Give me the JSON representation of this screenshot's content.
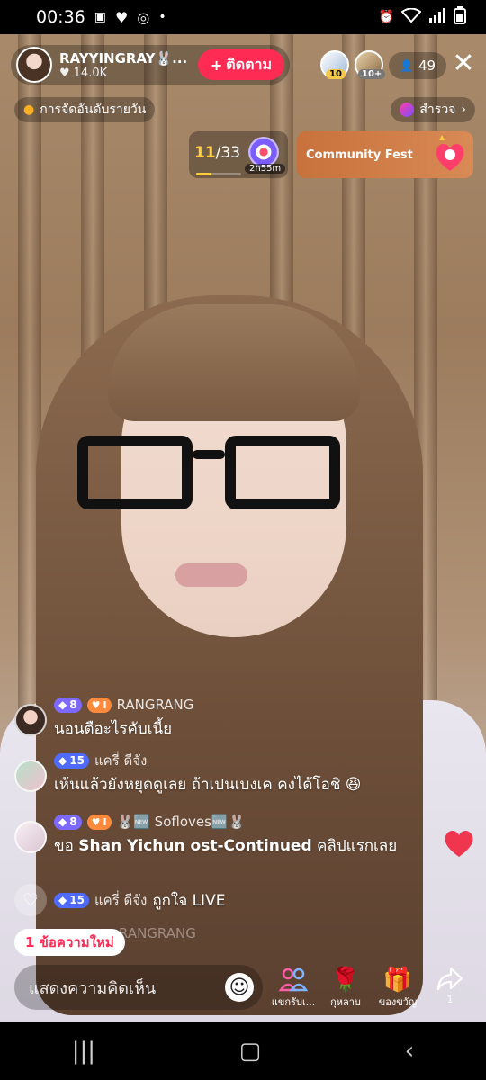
{
  "status_bar": {
    "time": "00:36",
    "dot": "•"
  },
  "host": {
    "name": "RAYYINGRAY🐰...",
    "likes": "14.0K",
    "follow_label": "ติดตาม"
  },
  "viewers": {
    "count": "49",
    "badge1": "10",
    "badge2": "10+"
  },
  "ranking": {
    "label": "การจัดอันดับรายวัน"
  },
  "explore": {
    "label": "สำรวจ"
  },
  "goal": {
    "done": "11",
    "total": "/33",
    "timer": "2h55m",
    "progress": 0.333
  },
  "fest": {
    "label": "Community Fest"
  },
  "chat": [
    {
      "level": "8",
      "fan": "I",
      "user": "RANGRANG",
      "message": "นอนตือะไรคับเนี้ย"
    },
    {
      "level": "15",
      "user": "แครี่ ดีจัง",
      "message": "เห้นแล้วยังหยุดดูเลย  ถ้าเปนเบงเค  คงได้โอชิ 😆"
    },
    {
      "level": "8",
      "fan": "I",
      "user": "🐰🆕 Sofloves🆕🐰",
      "message_prefix": "ขอ ",
      "message_bold": "Shan Yichun ost-Continued",
      "message_suffix": " คลิปแรกเลย"
    },
    {
      "level": "15",
      "user": "แครี่ ดีจัง",
      "message": "ถูกใจ LIVE"
    }
  ],
  "faded_user": "RANGRANG",
  "new_messages": "1 ข้อความใหม่",
  "comment_placeholder": "แสดงความคิดเห็น",
  "actions": [
    {
      "label": "แขกรับเ...",
      "icon": "guests-icon"
    },
    {
      "label": "กุหลาบ",
      "icon": "rose-icon"
    },
    {
      "label": "ของขวัญ",
      "icon": "gift-icon"
    },
    {
      "label": "1",
      "icon": "share-icon"
    }
  ],
  "colors": {
    "accent": "#fe2c55",
    "goal": "#ffcf3c"
  }
}
